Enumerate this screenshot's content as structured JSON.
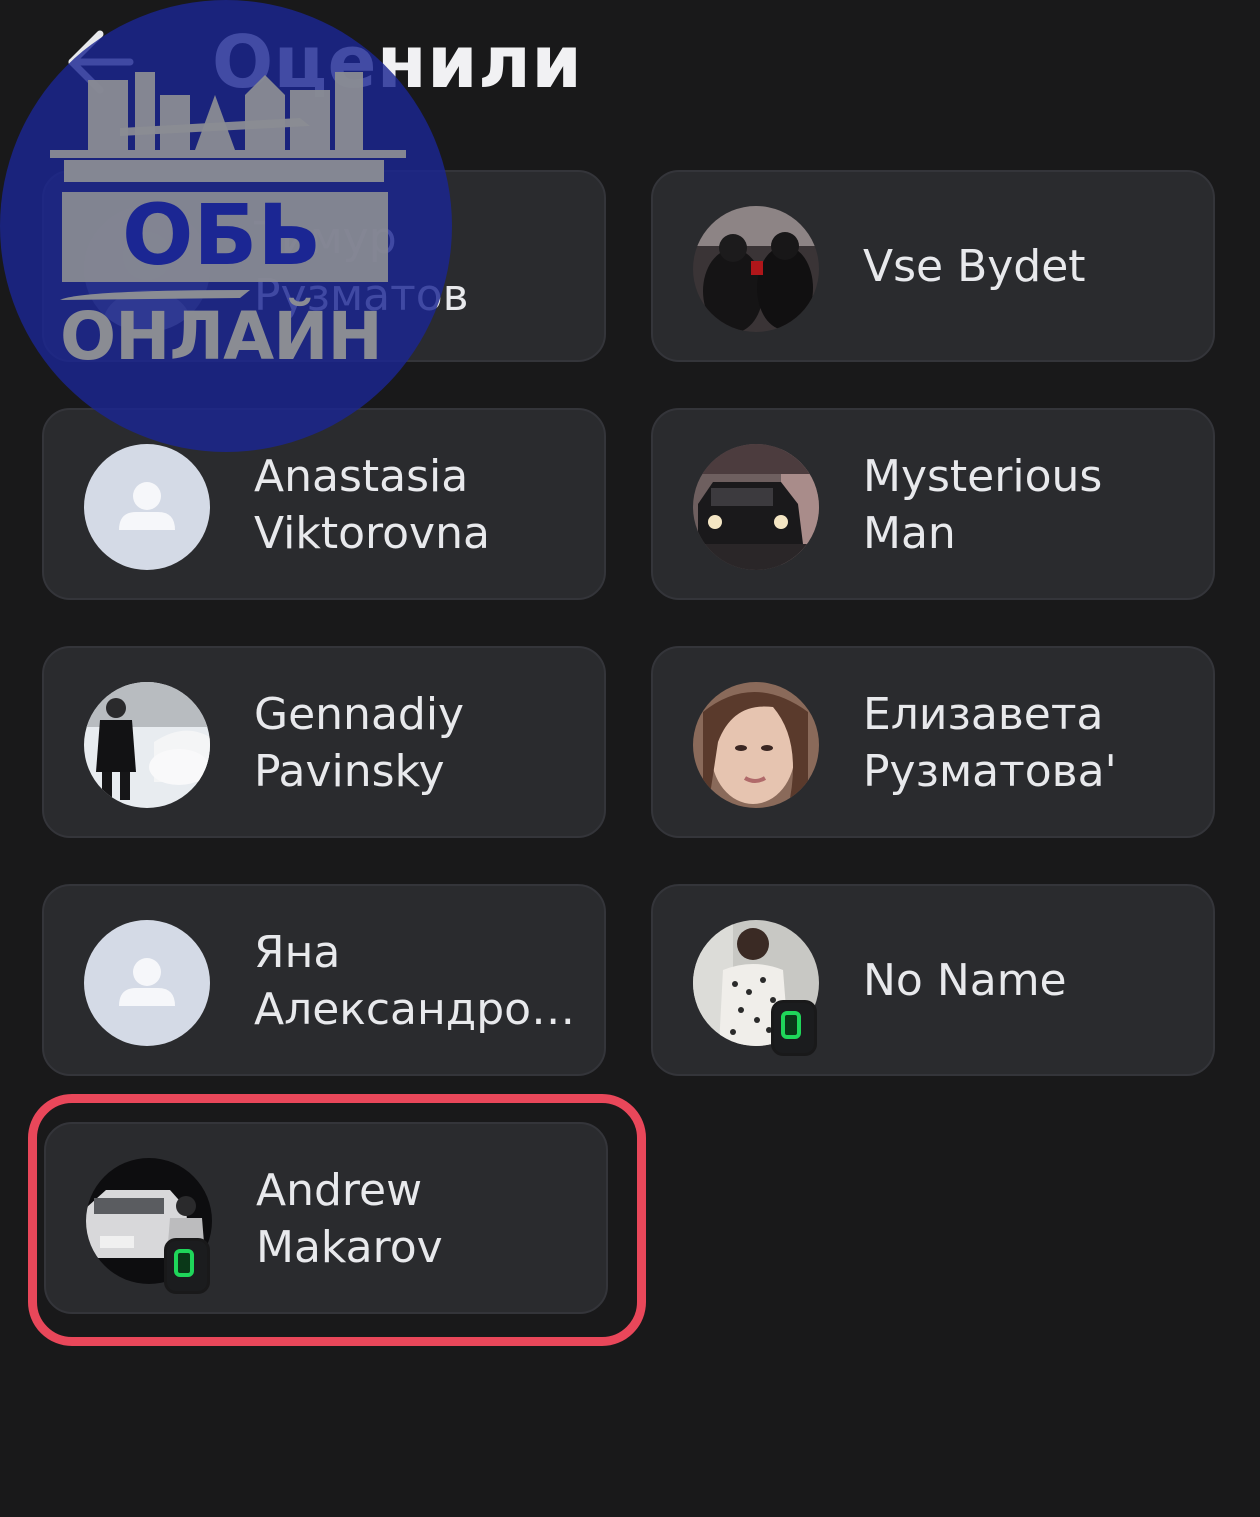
{
  "header": {
    "title": "Оценили"
  },
  "cards": [
    {
      "first": "Тимур",
      "last": "Рузматов"
    },
    {
      "first": "Vse Bydet",
      "last": ""
    },
    {
      "first": "Anastasia",
      "last": "Viktorovna"
    },
    {
      "first": "Mysterious",
      "last": "Man"
    },
    {
      "first": "Gennadiy",
      "last": "Pavinsky"
    },
    {
      "first": "Елизавета",
      "last": "Рузматова'"
    },
    {
      "first": "Яна",
      "last": "Александро…"
    },
    {
      "first": "No Name",
      "last": ""
    },
    {
      "first": "Andrew",
      "last": "Makarov"
    }
  ],
  "watermark": {
    "line1": "ОБЬ",
    "line2": "ОНЛАЙН"
  },
  "colors": {
    "background": "#19191a",
    "card": "#2a2b2e",
    "highlight": "#e9475a",
    "badge": "#1fd65a",
    "watermark": "#1b2693"
  }
}
